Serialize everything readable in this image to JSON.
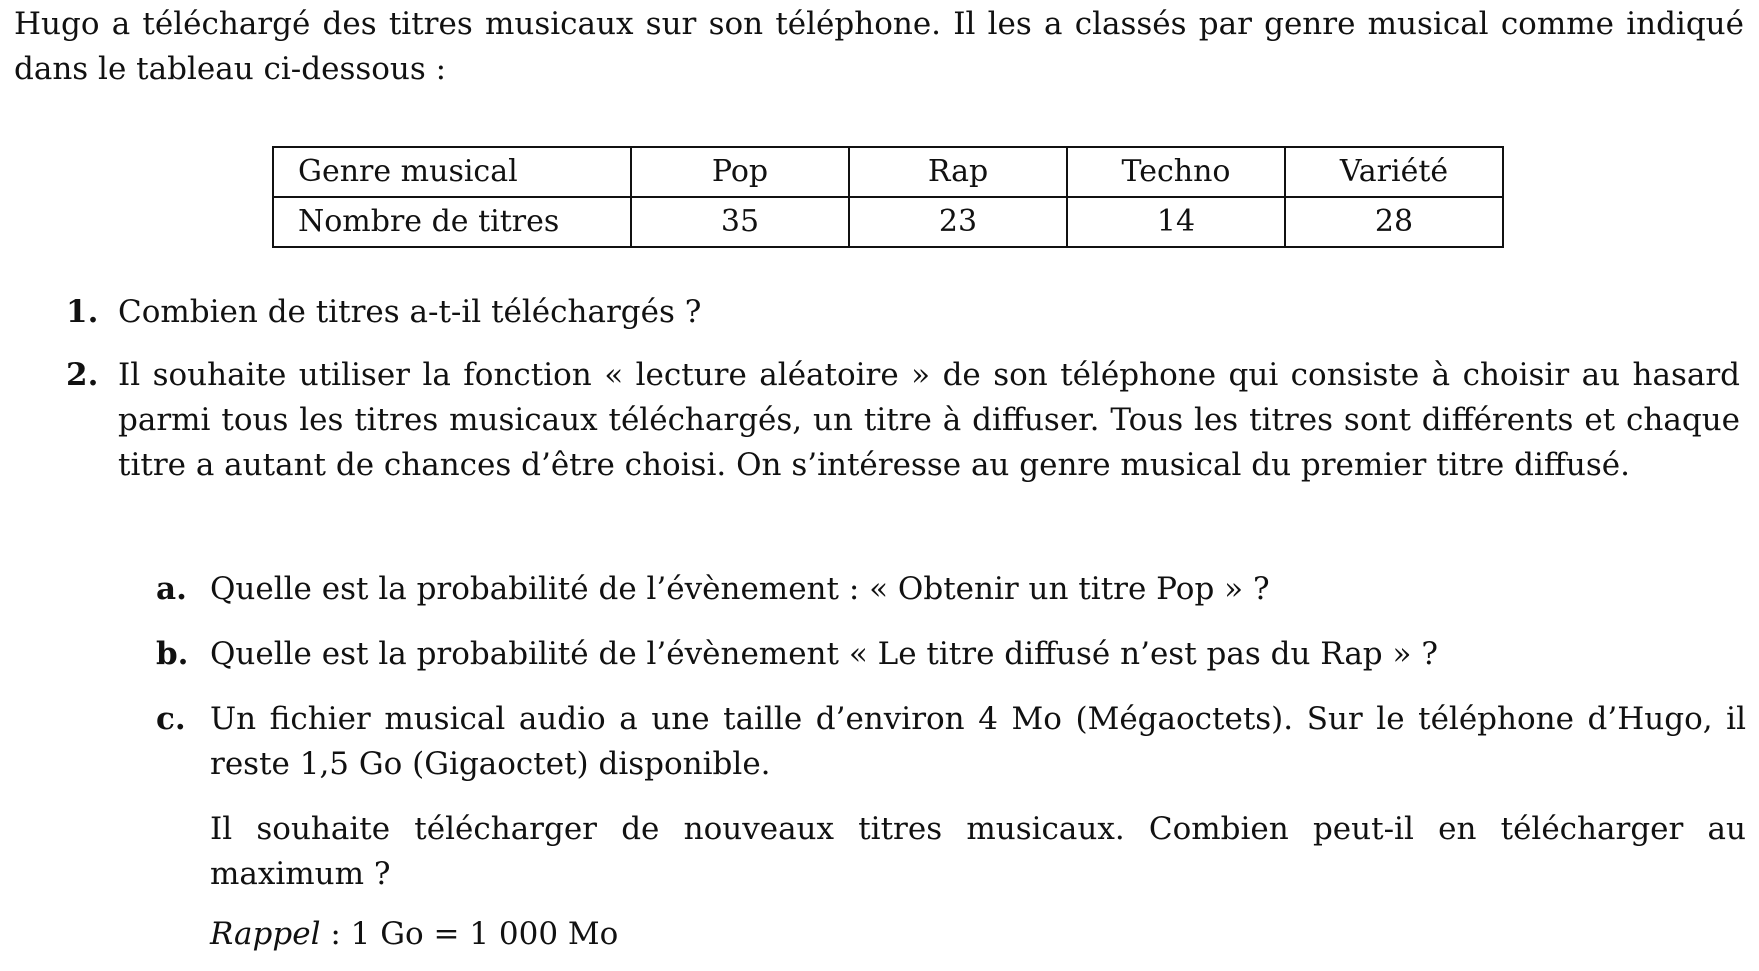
{
  "intro": "Hugo a téléchargé des titres musicaux sur son téléphone. Il les a classés par genre musical comme indiqué dans le tableau ci-dessous :",
  "table": {
    "header_label": "Genre musical",
    "genres": [
      "Pop",
      "Rap",
      "Techno",
      "Variété"
    ],
    "row_label": "Nombre de titres",
    "counts": [
      "35",
      "23",
      "14",
      "28"
    ]
  },
  "questions": {
    "q1": {
      "number": "1.",
      "text": "Combien de titres a-t-il téléchargés ?"
    },
    "q2": {
      "number": "2.",
      "text": "Il souhaite utiliser la fonction « lecture aléatoire » de son téléphone qui consiste à choisir au hasard parmi tous les titres musicaux téléchargés, un titre à diffuser. Tous les titres sont différents et chaque titre a autant de chances d’être choisi. On s’intéresse au genre musical du premier titre diffusé."
    },
    "qa": {
      "letter": "a.",
      "text": "Quelle est la probabilité de l’évènement : « Obtenir un titre Pop » ?"
    },
    "qb": {
      "letter": "b.",
      "text": "Quelle est la probabilité de l’évènement « Le titre diffusé n’est pas du Rap » ?"
    },
    "qc": {
      "letter": "c.",
      "text": "Un fichier musical audio a une taille d’environ 4 Mo (Mégaoctets). Sur le téléphone d’Hugo, il reste 1,5 Go (Gigaoctet) disponible.",
      "text2": "Il souhaite télécharger de nouveaux titres musicaux. Combien peut-il en télécharger au maximum ?",
      "rappel_label": "Rappel",
      "rappel_text": " : 1 Go = 1 000 Mo"
    }
  }
}
